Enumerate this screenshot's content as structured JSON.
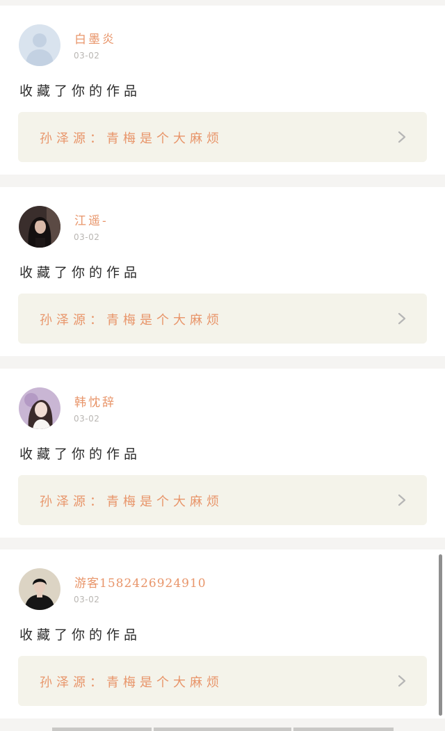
{
  "items": [
    {
      "username": "白墨炎",
      "date": "03-02",
      "action": "收藏了你的作品",
      "work_title": "孙泽源：青梅是个大麻烦",
      "avatar": "default-avatar"
    },
    {
      "username": "江遥-",
      "date": "03-02",
      "action": "收藏了你的作品",
      "work_title": "孙泽源：青梅是个大麻烦",
      "avatar": "photo-dark-hair-girl"
    },
    {
      "username": "韩忱辞",
      "date": "03-02",
      "action": "收藏了你的作品",
      "work_title": "孙泽源：青梅是个大麻烦",
      "avatar": "photo-girl-purple-background"
    },
    {
      "username": "游客1582426924910",
      "date": "03-02",
      "action": "收藏了你的作品",
      "work_title": "孙泽源：青梅是个大麻烦",
      "avatar": "photo-boy-dark-jacket"
    }
  ],
  "colors": {
    "accent": "#e8956a",
    "card_link_bg": "#f4f3ea",
    "page_bg": "#f5f4f2"
  },
  "icons": {
    "chevron": "chevron-right-icon"
  }
}
